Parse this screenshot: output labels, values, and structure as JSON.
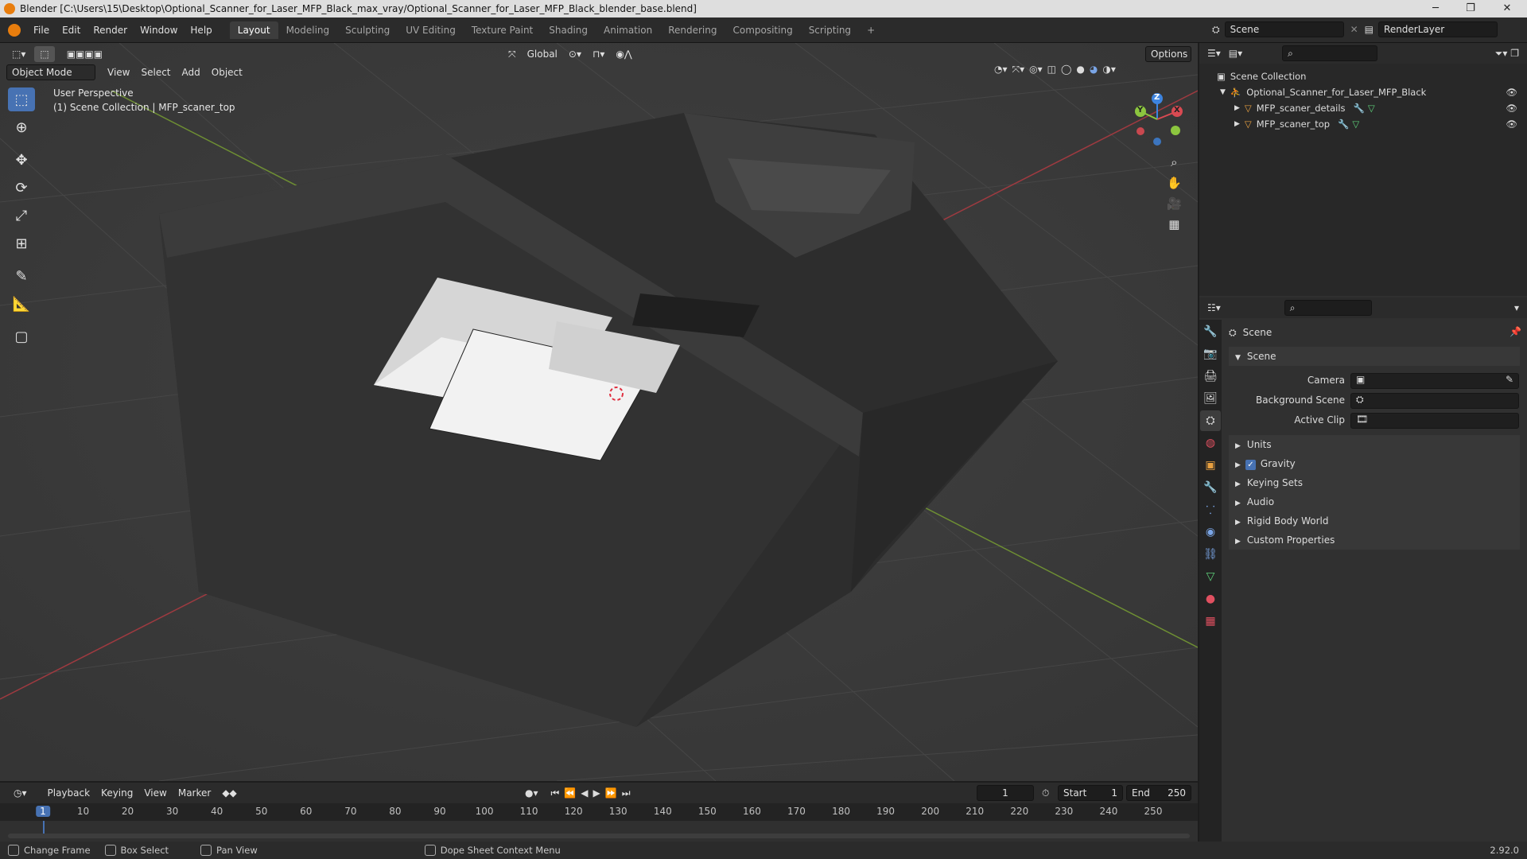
{
  "window": {
    "title": "Blender [C:\\Users\\15\\Desktop\\Optional_Scanner_for_Laser_MFP_Black_max_vray/Optional_Scanner_for_Laser_MFP_Black_blender_base.blend]",
    "minimize_icon": "minimize-icon",
    "maximize_icon": "maximize-icon",
    "close_icon": "close-icon"
  },
  "menubar": {
    "items": [
      "File",
      "Edit",
      "Render",
      "Window",
      "Help"
    ]
  },
  "workspaces": {
    "tabs": [
      "Layout",
      "Modeling",
      "Sculpting",
      "UV Editing",
      "Texture Paint",
      "Shading",
      "Animation",
      "Rendering",
      "Compositing",
      "Scripting"
    ],
    "active": "Layout",
    "add_label": "+"
  },
  "scene_selector": {
    "label": "Scene"
  },
  "view_layer_selector": {
    "label": "RenderLayer"
  },
  "viewport": {
    "mode": "Object Mode",
    "menus": [
      "View",
      "Select",
      "Add",
      "Object"
    ],
    "orientation": "Global",
    "options_label": "Options",
    "info_line1": "User Perspective",
    "info_line2": "(1) Scene Collection | MFP_scaner_top",
    "gizmo_axes": [
      "Z",
      "Y",
      "X"
    ],
    "colors": {
      "x_axis": "#d94a52",
      "y_axis": "#8cc63f",
      "z_axis": "#3d84e0",
      "grid": "#454545",
      "bg": "#3a3a3a",
      "selected": "#4772b3"
    }
  },
  "toolbar": {
    "tools": [
      "select-box-icon",
      "cursor-icon",
      "move-icon",
      "rotate-icon",
      "scale-icon",
      "transform-icon",
      "annotate-icon",
      "measure-icon",
      "add-cube-icon"
    ]
  },
  "outliner": {
    "root": "Scene Collection",
    "collection": "Optional_Scanner_for_Laser_MFP_Black",
    "objects": [
      "MFP_scaner_details",
      "MFP_scaner_top"
    ]
  },
  "properties": {
    "context_label": "Scene",
    "panel_title": "Scene",
    "fields": [
      {
        "label": "Camera",
        "value": ""
      },
      {
        "label": "Background Scene",
        "value": ""
      },
      {
        "label": "Active Clip",
        "value": ""
      }
    ],
    "subpanels": [
      "Units",
      "Gravity",
      "Keying Sets",
      "Audio",
      "Rigid Body World",
      "Custom Properties"
    ],
    "gravity_checked": true
  },
  "timeline": {
    "menus": [
      "Playback",
      "Keying",
      "View",
      "Marker"
    ],
    "current_frame": "1",
    "start_label": "Start",
    "start_value": "1",
    "end_label": "End",
    "end_value": "250",
    "ruler_ticks": [
      "1",
      "10",
      "20",
      "30",
      "40",
      "50",
      "60",
      "70",
      "80",
      "90",
      "100",
      "110",
      "120",
      "130",
      "140",
      "150",
      "160",
      "170",
      "180",
      "190",
      "200",
      "210",
      "220",
      "230",
      "240",
      "250"
    ]
  },
  "statusbar": {
    "items": [
      "Change Frame",
      "Box Select",
      "Pan View",
      "Dope Sheet Context Menu"
    ],
    "version": "2.92.0"
  }
}
